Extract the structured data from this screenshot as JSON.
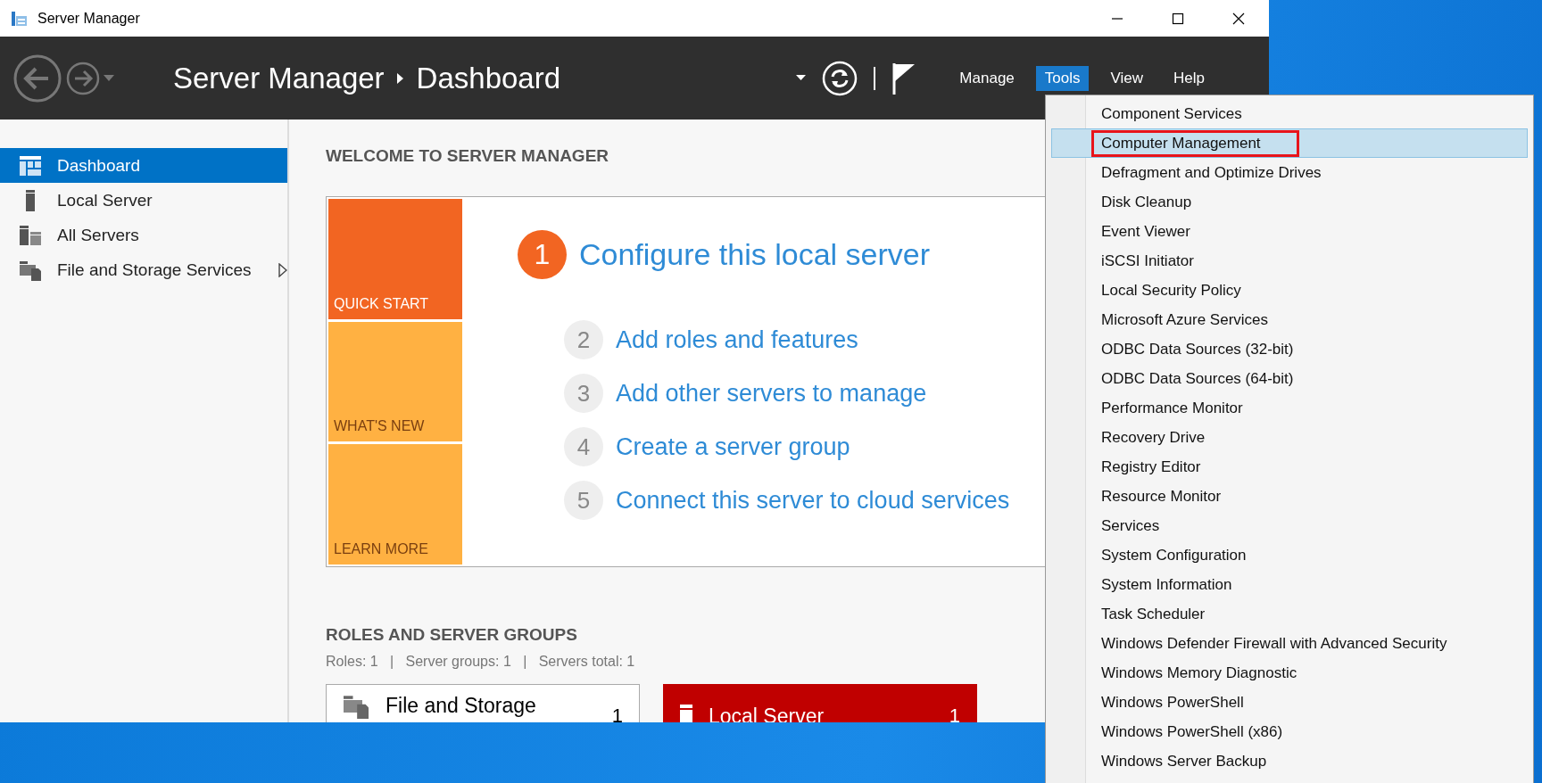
{
  "window": {
    "title": "Server Manager"
  },
  "header": {
    "breadcrumb": [
      "Server Manager",
      "Dashboard"
    ],
    "menus": [
      {
        "label": "Manage",
        "selected": false
      },
      {
        "label": "Tools",
        "selected": true
      },
      {
        "label": "View",
        "selected": false
      },
      {
        "label": "Help",
        "selected": false
      }
    ]
  },
  "sidebar": {
    "items": [
      {
        "label": "Dashboard",
        "selected": true,
        "expandable": false
      },
      {
        "label": "Local Server",
        "selected": false,
        "expandable": false
      },
      {
        "label": "All Servers",
        "selected": false,
        "expandable": false
      },
      {
        "label": "File and Storage Services",
        "selected": false,
        "expandable": true
      }
    ]
  },
  "welcome": {
    "heading": "WELCOME TO SERVER MANAGER",
    "tiles": [
      {
        "label": "QUICK START",
        "selected": true
      },
      {
        "label": "WHAT'S NEW",
        "selected": false
      },
      {
        "label": "LEARN MORE",
        "selected": false
      }
    ],
    "steps": [
      {
        "number": "1",
        "label": "Configure this local server",
        "current": true
      },
      {
        "number": "2",
        "label": "Add roles and features",
        "current": false
      },
      {
        "number": "3",
        "label": "Add other servers to manage",
        "current": false
      },
      {
        "number": "4",
        "label": "Create a server group",
        "current": false
      },
      {
        "number": "5",
        "label": "Connect this server to cloud services",
        "current": false
      }
    ]
  },
  "roles": {
    "heading": "ROLES AND SERVER GROUPS",
    "summary": "Roles: 1   |   Server groups: 1   |   Servers total: 1",
    "tiles": [
      {
        "label": "File and Storage",
        "count": "1",
        "alert": false
      },
      {
        "label": "Local Server",
        "count": "1",
        "alert": true
      }
    ]
  },
  "tools_menu": {
    "items": [
      {
        "label": "Component Services",
        "selected": false,
        "boxed": false
      },
      {
        "label": "Computer Management",
        "selected": true,
        "boxed": true
      },
      {
        "label": "Defragment and Optimize Drives",
        "selected": false,
        "boxed": false
      },
      {
        "label": "Disk Cleanup",
        "selected": false,
        "boxed": false
      },
      {
        "label": "Event Viewer",
        "selected": false,
        "boxed": false
      },
      {
        "label": "iSCSI Initiator",
        "selected": false,
        "boxed": false
      },
      {
        "label": "Local Security Policy",
        "selected": false,
        "boxed": false
      },
      {
        "label": "Microsoft Azure Services",
        "selected": false,
        "boxed": false
      },
      {
        "label": "ODBC Data Sources (32-bit)",
        "selected": false,
        "boxed": false
      },
      {
        "label": "ODBC Data Sources (64-bit)",
        "selected": false,
        "boxed": false
      },
      {
        "label": "Performance Monitor",
        "selected": false,
        "boxed": false
      },
      {
        "label": "Recovery Drive",
        "selected": false,
        "boxed": false
      },
      {
        "label": "Registry Editor",
        "selected": false,
        "boxed": false
      },
      {
        "label": "Resource Monitor",
        "selected": false,
        "boxed": false
      },
      {
        "label": "Services",
        "selected": false,
        "boxed": false
      },
      {
        "label": "System Configuration",
        "selected": false,
        "boxed": false
      },
      {
        "label": "System Information",
        "selected": false,
        "boxed": false
      },
      {
        "label": "Task Scheduler",
        "selected": false,
        "boxed": false
      },
      {
        "label": "Windows Defender Firewall with Advanced Security",
        "selected": false,
        "boxed": false
      },
      {
        "label": "Windows Memory Diagnostic",
        "selected": false,
        "boxed": false
      },
      {
        "label": "Windows PowerShell",
        "selected": false,
        "boxed": false
      },
      {
        "label": "Windows PowerShell (x86)",
        "selected": false,
        "boxed": false
      },
      {
        "label": "Windows Server Backup",
        "selected": false,
        "boxed": false
      }
    ]
  }
}
